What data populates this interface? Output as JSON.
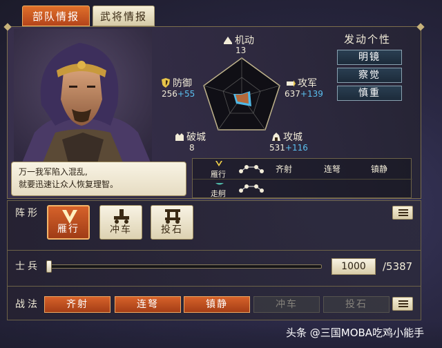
{
  "tabs": {
    "troop_info": "部队情报",
    "general_info": "武将情报"
  },
  "stats": {
    "mobility": {
      "label": "机动",
      "value": "13"
    },
    "defense": {
      "label": "防御",
      "base": "256",
      "bonus": "+55"
    },
    "attack": {
      "label": "攻军",
      "base": "637",
      "bonus": "+139"
    },
    "siege": {
      "label": "破城",
      "value": "8"
    },
    "assault": {
      "label": "攻城",
      "base": "531",
      "bonus": "+116"
    }
  },
  "skills": {
    "title": "发动个性",
    "items": [
      "明镜",
      "察觉",
      "慎重"
    ]
  },
  "dialogue": {
    "line1": "万一我军陷入混乱,",
    "line2": "就要迅速让众人恢复理智。"
  },
  "formation_table": {
    "rows": [
      {
        "formation": "雁行",
        "tactics": [
          "齐射",
          "连弩",
          "镇静"
        ]
      },
      {
        "formation": "走舸",
        "tactics": []
      }
    ]
  },
  "formation": {
    "label": "阵形",
    "options": [
      {
        "label": "雁行",
        "icon": "goose-formation-icon",
        "selected": true
      },
      {
        "label": "冲车",
        "icon": "battering-ram-icon",
        "selected": false
      },
      {
        "label": "投石",
        "icon": "catapult-icon",
        "selected": false
      }
    ]
  },
  "soldiers": {
    "label": "士兵",
    "value": "1000",
    "max": "/5387",
    "fraction": 0.0
  },
  "tactics": {
    "label": "战法",
    "items": [
      {
        "label": "齐射",
        "enabled": true
      },
      {
        "label": "连弩",
        "enabled": true
      },
      {
        "label": "镇静",
        "enabled": true
      },
      {
        "label": "冲车",
        "enabled": false
      },
      {
        "label": "投石",
        "enabled": false
      }
    ]
  },
  "watermark": "头条 @三国MOBA吃鸡小能手",
  "colors": {
    "accent": "#c8521f",
    "bonus": "#5bc0f0",
    "gold": "#c7b27a"
  }
}
